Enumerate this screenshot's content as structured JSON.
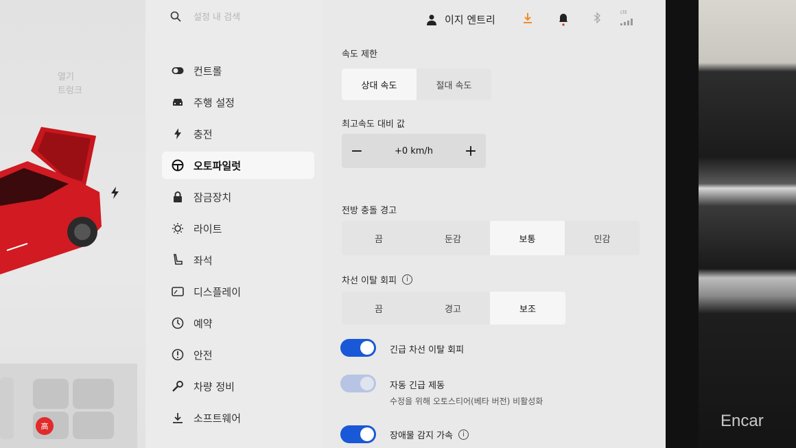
{
  "sidebar": {
    "search_placeholder": "설정 내 검색",
    "items": [
      {
        "label": "컨트롤",
        "icon": "toggle-icon"
      },
      {
        "label": "주행 설정",
        "icon": "car-icon"
      },
      {
        "label": "충전",
        "icon": "bolt-icon"
      },
      {
        "label": "오토파일럿",
        "icon": "steering-wheel-icon"
      },
      {
        "label": "잠금장치",
        "icon": "lock-icon"
      },
      {
        "label": "라이트",
        "icon": "light-icon"
      },
      {
        "label": "좌석",
        "icon": "seat-icon"
      },
      {
        "label": "디스플레이",
        "icon": "display-icon"
      },
      {
        "label": "예약",
        "icon": "clock-icon"
      },
      {
        "label": "안전",
        "icon": "info-circle-icon"
      },
      {
        "label": "차량 정비",
        "icon": "wrench-icon"
      },
      {
        "label": "소프트웨어",
        "icon": "download-icon"
      }
    ],
    "active_index": 3
  },
  "car_panel": {
    "trunk_label": "열기\n트렁크",
    "seat_badge": "高"
  },
  "topbar": {
    "profile_name": "이지 엔트리",
    "lte_label": "LTE"
  },
  "main": {
    "speed_limit": {
      "label": "속도 제한",
      "options": [
        "상대 속도",
        "절대 속도"
      ],
      "selected": "상대 속도"
    },
    "speed_offset": {
      "label": "최고속도 대비 값",
      "value": "+0 km/h",
      "minus": "−",
      "plus": "+"
    },
    "forward_collision": {
      "label": "전방 충돌 경고",
      "options": [
        "끔",
        "둔감",
        "보통",
        "민감"
      ],
      "selected": "보통"
    },
    "lane_departure": {
      "label": "차선 이탈 회피",
      "options": [
        "끔",
        "경고",
        "보조"
      ],
      "selected": "보조"
    },
    "toggles": [
      {
        "label": "긴급 차선 이탈 회피",
        "on": true,
        "disabled": false,
        "sub": ""
      },
      {
        "label": "자동 긴급 제동",
        "on": true,
        "disabled": true,
        "sub": "수정을 위해 오토스티어(베타 버전) 비활성화"
      },
      {
        "label": "장애물 감지 가속",
        "on": true,
        "disabled": false,
        "sub": ""
      }
    ]
  },
  "watermark": "Encar",
  "colors": {
    "accent": "#1958d6",
    "download": "#f08a24",
    "alert": "#e12b2b"
  }
}
